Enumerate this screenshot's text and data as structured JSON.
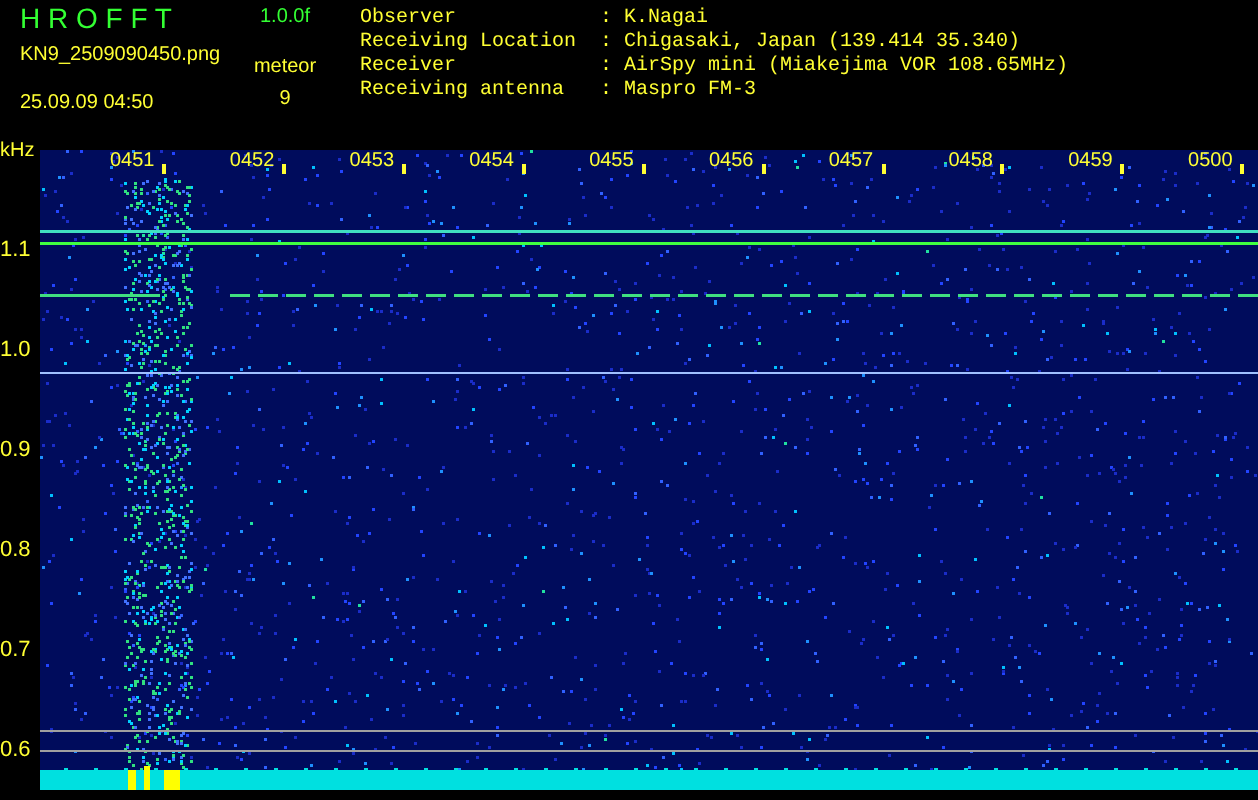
{
  "header": {
    "app_name": "H R O F F T",
    "version": "1.0.0f",
    "filename": "KN9_2509090450.png",
    "datetime": "25.09.09 04:50",
    "count_label": "meteor",
    "count": "9"
  },
  "info": [
    {
      "label": "Observer",
      "separator": ":",
      "value": "K.Nagai"
    },
    {
      "label": "Receiving Location",
      "separator": ":",
      "value": "Chigasaki, Japan (139.414 35.340)"
    },
    {
      "label": "Receiver",
      "separator": ":",
      "value": "AirSpy mini (Miakejima VOR 108.65MHz)"
    },
    {
      "label": "Receiving antenna",
      "separator": ":",
      "value": "Maspro FM-3"
    }
  ],
  "spectrogram": {
    "freq_unit": "kHz",
    "freq_labels": [
      "1.1",
      "1.0",
      "0.9",
      "0.8",
      "0.7",
      "0.6"
    ],
    "time_labels": [
      "0451",
      "0452",
      "0453",
      "0454",
      "0455",
      "0456",
      "0457",
      "0458",
      "0459",
      "0500"
    ]
  }
}
